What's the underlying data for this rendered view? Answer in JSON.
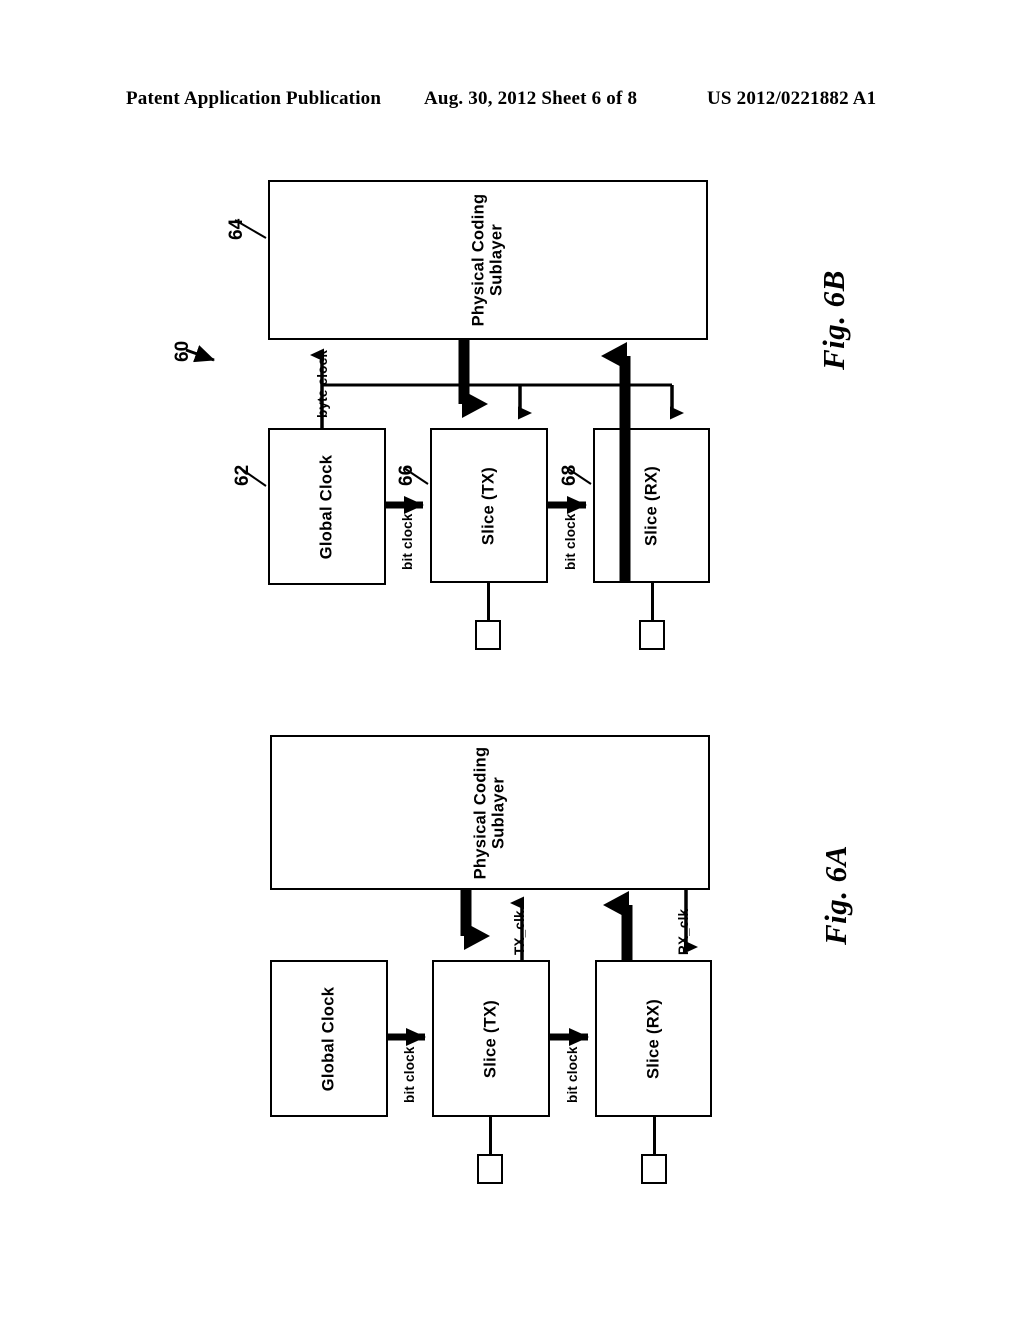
{
  "header": {
    "publication": "Patent Application Publication",
    "date_sheet": "Aug. 30, 2012  Sheet 6 of 8",
    "patent_number": "US 2012/0221882 A1"
  },
  "figures": [
    {
      "id": "fig6b",
      "caption": "Fig. 6B",
      "system_ref": "60",
      "blocks": [
        {
          "name": "pcs",
          "label": "Physical Coding\nSublayer",
          "ref": "64"
        },
        {
          "name": "global-clock",
          "label": "Global Clock",
          "ref": "62"
        },
        {
          "name": "slice-tx",
          "label": "Slice (TX)",
          "ref": "66"
        },
        {
          "name": "slice-rx",
          "label": "Slice (RX)",
          "ref": "68"
        }
      ],
      "signals": [
        {
          "name": "byte-clock",
          "label": "byte clock"
        },
        {
          "name": "bit-clock-tx",
          "label": "bit clock"
        },
        {
          "name": "bit-clock-rx",
          "label": "bit clock"
        }
      ]
    },
    {
      "id": "fig6a",
      "caption": "Fig. 6A",
      "blocks": [
        {
          "name": "pcs",
          "label": "Physical Coding\nSublayer"
        },
        {
          "name": "global-clock",
          "label": "Global Clock"
        },
        {
          "name": "slice-tx",
          "label": "Slice (TX)"
        },
        {
          "name": "slice-rx",
          "label": "Slice (RX)"
        }
      ],
      "signals": [
        {
          "name": "tx-clk",
          "label": "TX_clk"
        },
        {
          "name": "rx-clk",
          "label": "RX_clk"
        },
        {
          "name": "bit-clock-tx",
          "label": "bit clock"
        },
        {
          "name": "bit-clock-rx",
          "label": "bit clock"
        }
      ]
    }
  ],
  "colors": {
    "ink": "#000000",
    "paper": "#ffffff"
  }
}
